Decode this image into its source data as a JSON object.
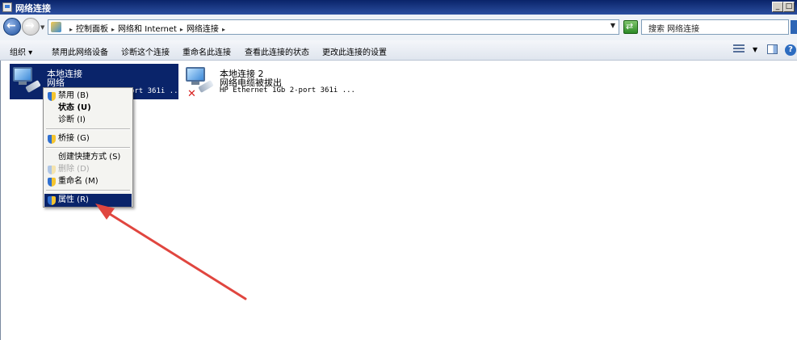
{
  "window": {
    "title": "网络连接"
  },
  "address": {
    "crumbs": [
      "控制面板",
      "网络和 Internet",
      "网络连接"
    ],
    "search_placeholder": "搜索 网络连接"
  },
  "toolbar": {
    "items": [
      "组织 ▾",
      "禁用此网络设备",
      "诊断这个连接",
      "重命名此连接",
      "查看此连接的状态",
      "更改此连接的设置"
    ]
  },
  "connections": [
    {
      "name": "本地连接",
      "status": "网络",
      "device": "HP Ethernet 1Gb 2-port 361i ...",
      "selected": true
    },
    {
      "name": "本地连接 2",
      "status": "网络电缆被拔出",
      "device": "HP Ethernet 1Gb 2-port 361i ...",
      "selected": false
    }
  ],
  "context_menu": {
    "items": [
      {
        "label": "禁用 (B)"
      },
      {
        "label": "状态 (U)"
      },
      {
        "label": "诊断 (I)"
      },
      {
        "label": "桥接 (G)"
      },
      {
        "label": "创建快捷方式 (S)"
      },
      {
        "label": "删除 (D)"
      },
      {
        "label": "重命名 (M)"
      },
      {
        "label": "属性 (R)"
      }
    ]
  },
  "annotation": {
    "arrow_color": "#e0463f"
  }
}
